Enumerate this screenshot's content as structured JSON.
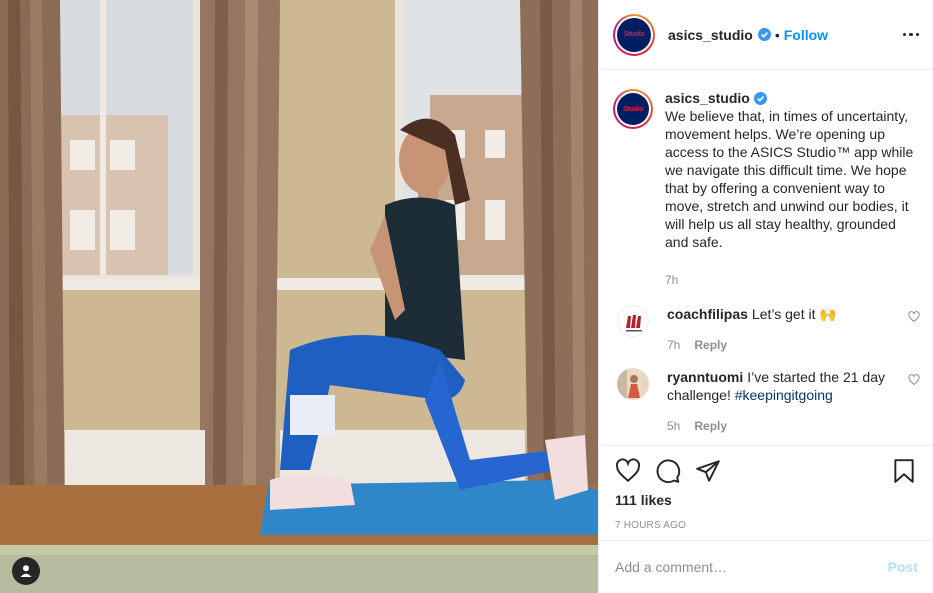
{
  "post": {
    "image_alt": "Woman doing a lunge on a blue yoga mat in front of a window"
  },
  "header": {
    "username": "asics_studio",
    "logo_text": "Studio",
    "separator": "•",
    "follow_label": "Follow"
  },
  "caption": {
    "username": "asics_studio",
    "text": "We believe that, in times of uncertainty, movement helps. We’re opening up access to the ASICS Studio™ app while we navigate this difficult time. We hope that by offering a convenient way to move, stretch and unwind our bodies, it will help us all stay healthy, grounded and safe.",
    "time": "7h"
  },
  "comments": [
    {
      "username": "coachfilipas",
      "text": "Let’s get it 🙌",
      "time": "7h",
      "reply_label": "Reply"
    },
    {
      "username": "ryanntuomi",
      "text": "I’ve started the 21 day challenge!",
      "hashtag": "#keepingitgoing",
      "time": "5h",
      "reply_label": "Reply"
    }
  ],
  "actions": {
    "likes": "111 likes",
    "time_ago": "7 HOURS AGO"
  },
  "add_comment": {
    "placeholder": "Add a comment…",
    "post_label": "Post"
  },
  "icons": [
    "user-tag-icon",
    "verified-icon",
    "more-options-icon",
    "heart-icon",
    "comment-icon",
    "share-icon",
    "bookmark-icon"
  ],
  "colors": {
    "link_blue": "#0095f6",
    "post_disabled": "#b2dffc",
    "asics_navy": "#001e62",
    "asics_red": "#e01f3d",
    "muted_gray": "#8e8e8e"
  }
}
